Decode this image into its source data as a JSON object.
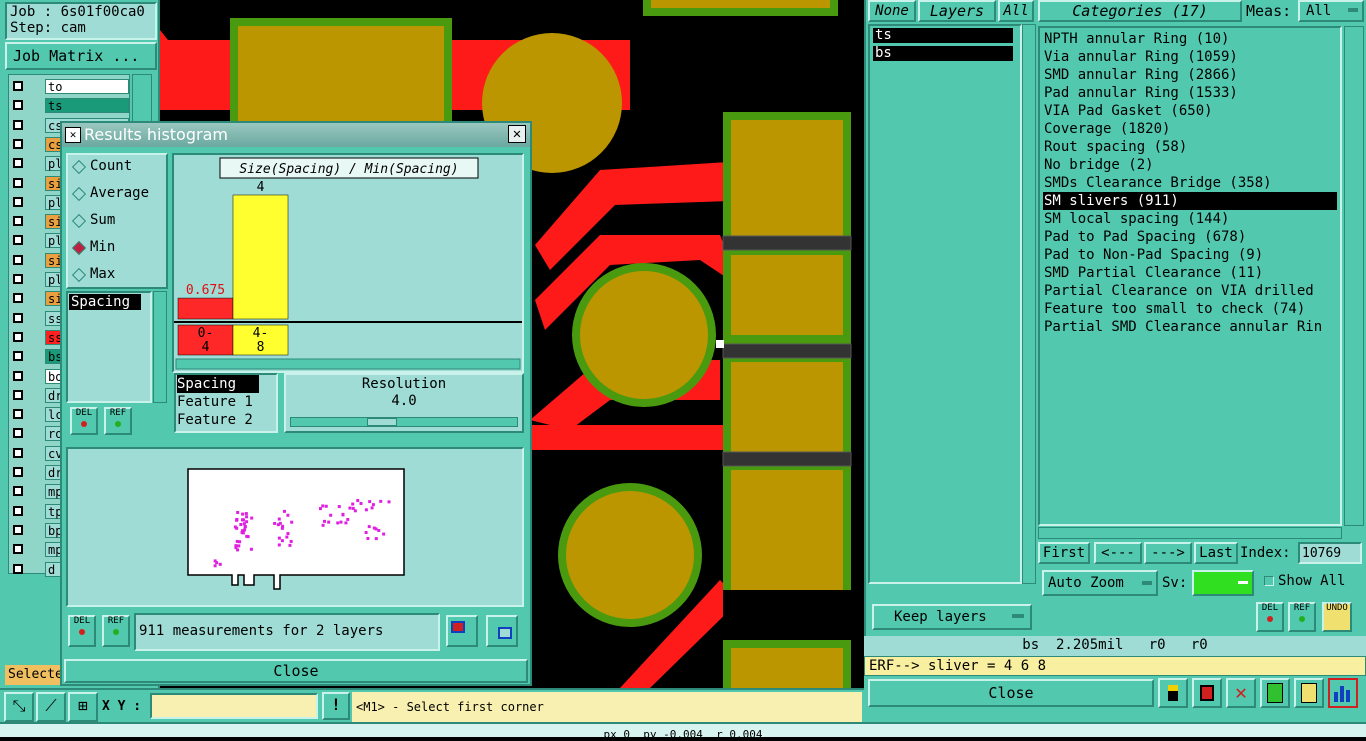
{
  "job": {
    "job_label": "Job : 6s01f00ca0",
    "step_label": "Step: cam",
    "matrix_button": "Job Matrix ..."
  },
  "layers_left": [
    {
      "name": "to",
      "color": "#ffffff"
    },
    {
      "name": "ts",
      "color": "#1a9a78"
    },
    {
      "name": "cs",
      "color": "#9fdcd6"
    },
    {
      "name": "cs",
      "color": "#e8a040"
    },
    {
      "name": "pl",
      "color": "#9fdcd6"
    },
    {
      "name": "si",
      "color": "#e8a040"
    },
    {
      "name": "pl",
      "color": "#9fdcd6"
    },
    {
      "name": "si",
      "color": "#e8a040"
    },
    {
      "name": "pl",
      "color": "#9fdcd6"
    },
    {
      "name": "si",
      "color": "#e8a040"
    },
    {
      "name": "pl",
      "color": "#9fdcd6"
    },
    {
      "name": "si",
      "color": "#e8a040"
    },
    {
      "name": "ss",
      "color": "#9fdcd6"
    },
    {
      "name": "ss",
      "color": "#ff2020"
    },
    {
      "name": "bs",
      "color": "#1a9a78"
    },
    {
      "name": "bo",
      "color": "#ffffff"
    },
    {
      "name": "dr",
      "color": "#9fdcd6"
    },
    {
      "name": "lc",
      "color": "#9fdcd6"
    },
    {
      "name": "ro",
      "color": "#9fdcd6"
    },
    {
      "name": "cv",
      "color": "#9fdcd6"
    },
    {
      "name": "dr",
      "color": "#9fdcd6"
    },
    {
      "name": "mp",
      "color": "#9fdcd6"
    },
    {
      "name": "tp",
      "color": "#9fdcd6"
    },
    {
      "name": "bp",
      "color": "#9fdcd6"
    },
    {
      "name": "mp",
      "color": "#9fdcd6"
    },
    {
      "name": "d",
      "color": "#9fdcd6"
    }
  ],
  "selected_label": "Selecte",
  "histogram": {
    "title": "Results histogram",
    "modes": [
      "Count",
      "Average",
      "Sum",
      "Min",
      "Max"
    ],
    "selected_mode": "Min",
    "measure_list": [
      "Spacing"
    ],
    "del_label": "DEL",
    "ref_label": "REF",
    "chart_title": "Size(Spacing) / Min(Spacing)",
    "params": [
      "Spacing",
      "Feature 1",
      "Feature 2"
    ],
    "resolution_label": "Resolution",
    "resolution_value": "4.0",
    "status": "911 measurements for 2 layers",
    "close_label": "Close"
  },
  "chart_data": {
    "type": "bar",
    "title": "Size(Spacing) / Min(Spacing)",
    "categories": [
      "0-\n4",
      "4-\n8"
    ],
    "values": [
      0.675,
      4
    ],
    "value_labels": [
      "0.675",
      "4"
    ],
    "colors": [
      "#ff2828",
      "#ffff30"
    ]
  },
  "bottom_bar": {
    "xy_label": "X Y :",
    "xy_value": "",
    "prompt": "<M1> - Select first corner",
    "coords": "px 0  py -0.004  r 0.004"
  },
  "layers_panel": {
    "tab_none": "None",
    "tab_layers": "Layers",
    "tab_all": "All",
    "items": [
      "ts",
      "bs"
    ],
    "keep_layers": "Keep layers"
  },
  "categories_panel": {
    "header": "Categories (17)",
    "meas_label": "Meas:",
    "meas_value": "All",
    "items": [
      "NPTH annular Ring (10)",
      "Via annular Ring (1059)",
      "SMD annular Ring (2866)",
      "Pad annular Ring (1533)",
      "VIA Pad Gasket (650)",
      "Coverage (1820)",
      "Rout spacing (58)",
      "No bridge (2)",
      "SMDs Clearance Bridge (358)",
      "SM slivers (911)",
      "SM local spacing (144)",
      "Pad to Pad Spacing (678)",
      "Pad to Non-Pad Spacing (9)",
      "SMD Partial Clearance (11)",
      "Partial Clearance on VIA drilled",
      "Feature too small to check (74)",
      "Partial SMD Clearance annular Rin"
    ],
    "selected_index": 9,
    "nav": {
      "first": "First",
      "prev": "<---",
      "next": "--->",
      "last": "Last",
      "index_label": "Index:",
      "index_value": "10769"
    },
    "auto_zoom": "Auto Zoom",
    "sv_label": "Sv:",
    "show_all": "Show All",
    "info_line": "bs  2.205mil   r0   r0",
    "erf_line": "ERF--> sliver = 4 6 8",
    "close_label": "Close",
    "undo_label": "UNDO"
  },
  "icons": [
    "zoom-fit-icon",
    "measure-icon",
    "grid-icon",
    "warning-icon",
    "histogram-icon",
    "report-icon"
  ]
}
